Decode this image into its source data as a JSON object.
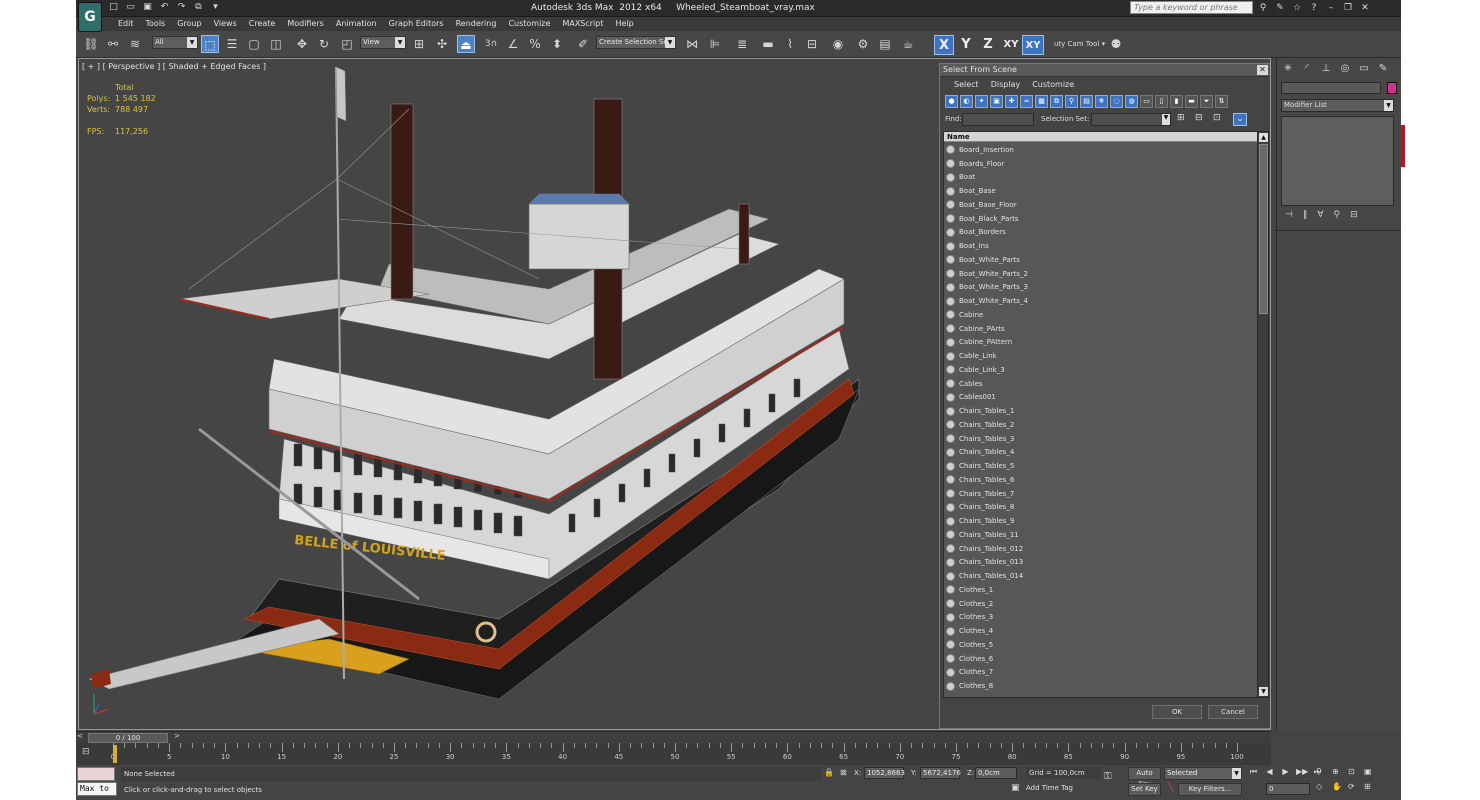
{
  "app": {
    "title": "Autodesk 3ds Max  2012 x64     Wheeled_Steamboat_vray.max",
    "logo_letter": "G",
    "search_placeholder": "Type a keyword or phrase"
  },
  "menu": [
    "Edit",
    "Tools",
    "Group",
    "Views",
    "Create",
    "Modifiers",
    "Animation",
    "Graph Editors",
    "Rendering",
    "Customize",
    "MAXScript",
    "Help"
  ],
  "toolbar": {
    "filter_value": "All",
    "refcoord_value": "View",
    "named_selection_placeholder": "Create Selection Se",
    "snap_3": "3",
    "axis_x": "X",
    "axis_y": "Y",
    "axis_z": "Z",
    "axis_xy": "XY",
    "axis_xy2": "XY",
    "cam_tool": "uty Cam Tool ▾"
  },
  "viewport": {
    "label": "[ + ] [ Perspective ] [ Shaded + Edged Faces ]",
    "stats_header": "Total",
    "polys_label": "Polys:",
    "polys_value": "1 545 182",
    "verts_label": "Verts:",
    "verts_value": "788 497",
    "fps_label": "FPS:",
    "fps_value": "117,256",
    "boat_lettering": "BELLE of LOUISVILLE"
  },
  "dialog": {
    "title": "Select From Scene",
    "menu": [
      "Select",
      "Display",
      "Customize"
    ],
    "find_label": "Find:",
    "selset_label": "Selection Set:",
    "column_name": "Name",
    "items": [
      "Board_Insertion",
      "Boards_Floor",
      "Boat",
      "Boat_Base",
      "Boat_Base_Floor",
      "Boat_Black_Parts",
      "Boat_Borders",
      "Boat_Ins",
      "Boat_White_Parts",
      "Boat_White_Parts_2",
      "Boat_White_Parts_3",
      "Boat_White_Parts_4",
      "Cabine",
      "Cabine_PArts",
      "Cabine_PAttern",
      "Cable_Link",
      "Cable_Link_3",
      "Cables",
      "Cables001",
      "Chairs_Tables_1",
      "Chairs_Tables_2",
      "Chairs_Tables_3",
      "Chairs_Tables_4",
      "Chairs_Tables_5",
      "Chairs_Tables_6",
      "Chairs_Tables_7",
      "Chairs_Tables_8",
      "Chairs_Tables_9",
      "Chairs_Tables_11",
      "Chairs_Tables_012",
      "Chairs_Tables_013",
      "Chairs_Tables_014",
      "Clothes_1",
      "Clothes_2",
      "Clothes_3",
      "Clothes_4",
      "Clothes_5",
      "Clothes_6",
      "Clothes_7",
      "Clothes_8"
    ],
    "ok_label": "OK",
    "cancel_label": "Cancel"
  },
  "command_panel": {
    "modifier_list": "Modifier List",
    "color_swatch": "#d42f8f"
  },
  "timeline": {
    "slider_text": "0 / 100",
    "ticks": [
      "0",
      "5",
      "10",
      "15",
      "20",
      "25",
      "30",
      "35",
      "40",
      "45",
      "50",
      "55",
      "60",
      "65",
      "70",
      "75",
      "80",
      "85",
      "90",
      "95",
      "100"
    ]
  },
  "status": {
    "selection": "None Selected",
    "prompt": "Click or click-and-drag to select objects",
    "maxscript_label": "Max to",
    "x_label": "X:",
    "x_value": "1052,8663",
    "y_label": "Y:",
    "y_value": "5672,4176",
    "z_label": "Z:",
    "z_value": "0,0cm",
    "grid": "Grid = 100,0cm",
    "add_time_tag": "Add Time Tag",
    "auto_key": "Auto Key",
    "set_key": "Set Key",
    "selected_value": "Selected",
    "key_filters": "Key Filters...",
    "frame_value": "0"
  },
  "icons": {
    "quick_access": [
      "new-icon",
      "open-icon",
      "save-icon",
      "undo-icon",
      "redo-icon",
      "project-icon",
      "render-frame-icon"
    ],
    "info": [
      "binoculars-icon",
      "tools-icon",
      "star-icon",
      "help-icon",
      "minimize-icon",
      "restore-icon",
      "close-icon"
    ]
  }
}
